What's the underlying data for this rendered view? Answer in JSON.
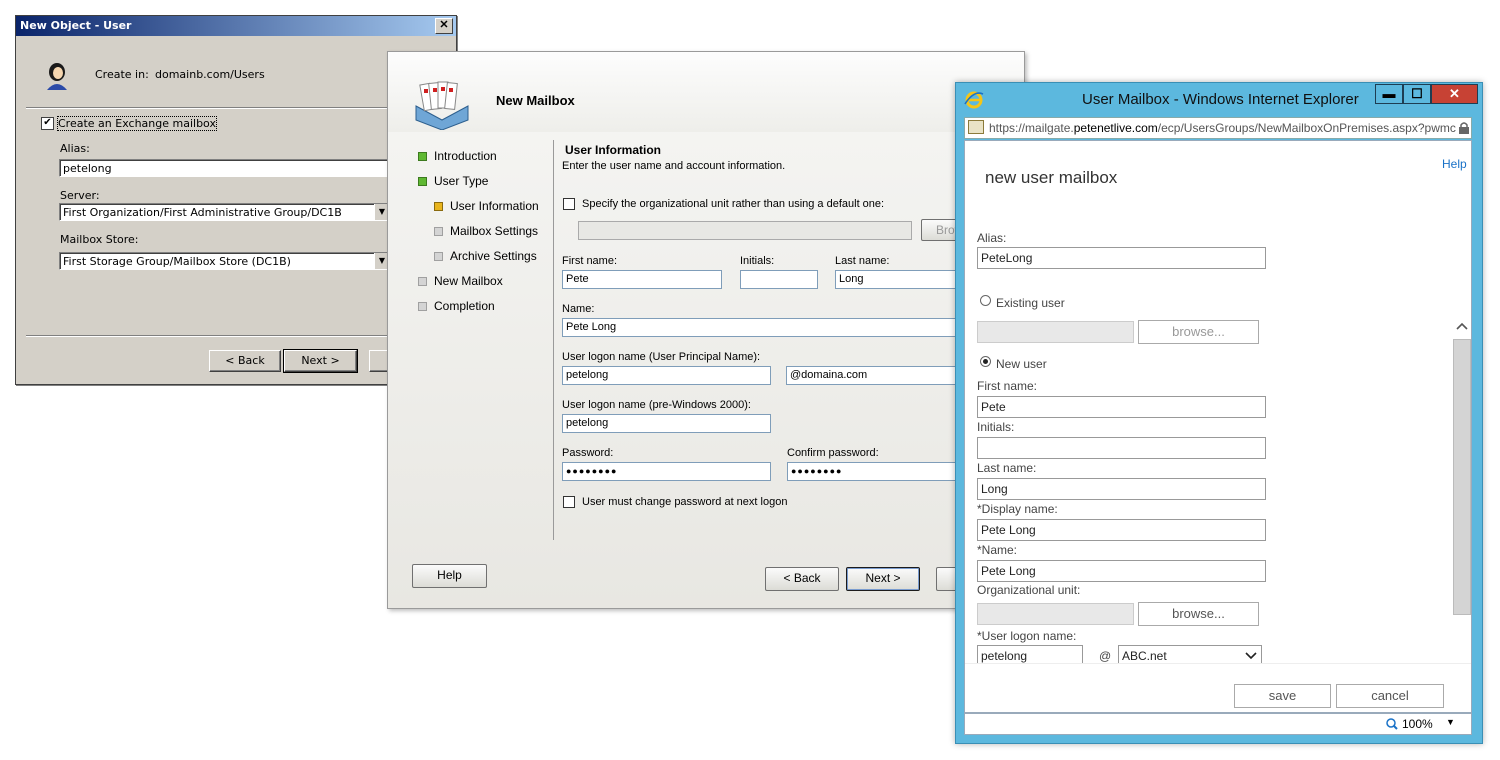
{
  "w1": {
    "title": "New Object - User",
    "close_glyph": "✕",
    "create_in_label": "Create in:",
    "create_in_value": "domainb.com/Users",
    "checkbox_label": "Create an Exchange mailbox",
    "checkbox_checked": true,
    "alias_label": "Alias:",
    "alias_value": "petelong",
    "server_label": "Server:",
    "server_value": "First Organization/First Administrative Group/DC1B",
    "store_label": "Mailbox Store:",
    "store_value": "First Storage Group/Mailbox Store (DC1B)",
    "back_label": "< Back",
    "next_label": "Next >"
  },
  "w2": {
    "title": "New Mailbox",
    "nav": [
      {
        "label": "Introduction",
        "state": "green"
      },
      {
        "label": "User Type",
        "state": "green"
      },
      {
        "label": "User Information",
        "state": "yellow"
      },
      {
        "label": "Mailbox Settings",
        "state": "gray"
      },
      {
        "label": "Archive Settings",
        "state": "gray"
      },
      {
        "label": "New Mailbox",
        "state": "gray"
      },
      {
        "label": "Completion",
        "state": "gray"
      }
    ],
    "section_title": "User Information",
    "section_desc": "Enter the user name and account information.",
    "ou_checkbox_label": "Specify the organizational unit rather than using a default one:",
    "browse_label": "Brow",
    "first_name_label": "First name:",
    "first_name_value": "Pete",
    "initials_label": "Initials:",
    "initials_value": "",
    "last_name_label": "Last name:",
    "last_name_value": "Long",
    "name_label": "Name:",
    "name_value": "Pete Long",
    "upn_label": "User logon name (User Principal Name):",
    "upn_value": "petelong",
    "upn_domain": "@domaina.com",
    "prewin_label": "User logon name (pre-Windows 2000):",
    "prewin_value": "petelong",
    "password_label": "Password:",
    "password_value": "●●●●●●●●",
    "confirm_label": "Confirm password:",
    "confirm_value": "●●●●●●●●",
    "change_pw_label": "User must change password at next logon",
    "help_label": "Help",
    "back_label": "< Back",
    "next_label": "Next >"
  },
  "w3": {
    "title": "User Mailbox - Windows Internet Explorer",
    "min_glyph": "▬",
    "max_glyph": "☐",
    "close_glyph": "✕",
    "url_prefix": "https://mailgate.",
    "url_domain": "petenetlive.com",
    "url_rest": "/ecp/UsersGroups/NewMailboxOnPremises.aspx?pwmc",
    "help_link": "Help",
    "page_heading": "new user mailbox",
    "alias_label": "Alias:",
    "alias_value": "PeteLong",
    "existing_user_label": "Existing user",
    "browse_label": "browse...",
    "new_user_label": "New user",
    "first_name_label": "First name:",
    "first_name_value": "Pete",
    "initials_label": "Initials:",
    "initials_value": "",
    "last_name_label": "Last name:",
    "last_name_value": "Long",
    "display_name_label": "*Display name:",
    "display_name_value": "Pete Long",
    "name_label": "*Name:",
    "name_value": "Pete Long",
    "ou_label": "Organizational unit:",
    "logon_label": "*User logon name:",
    "logon_value": "petelong",
    "at_sign": "@",
    "domain_value": "ABC.net",
    "save_label": "save",
    "cancel_label": "cancel",
    "zoom_label": "100%",
    "scroll_up_glyph": "⌃",
    "scroll_down_glyph": "⌄"
  }
}
